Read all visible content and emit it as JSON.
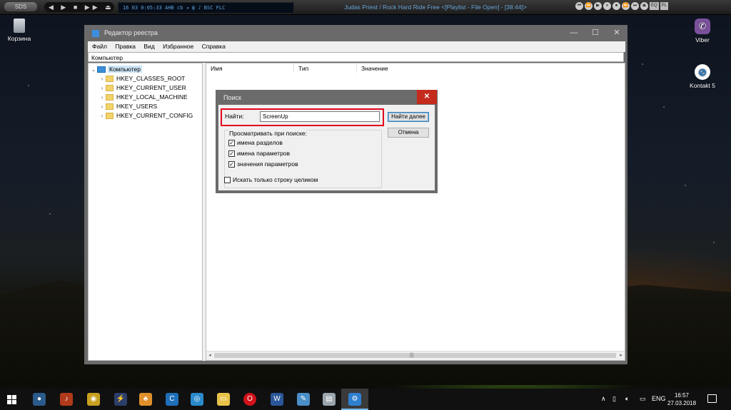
{
  "winamp": {
    "logo": "SDS",
    "controls": "◀ ▶ ■ ▶▶ ⏏",
    "display": "16   03   0:05:33   AHB cb ◂ ф ♪   BSC   FLC",
    "track_title": "Judas Priest / Rock Hard Ride Free   <[Playlist - File Open] - [38:44]>",
    "buttons": [
      "⏮",
      "⏪",
      "▶",
      "⏸",
      "⏹",
      "⏩",
      "⏭",
      "⏏"
    ],
    "mode_labels": [
      "EQ",
      "PL"
    ]
  },
  "desktop_icons": [
    {
      "label": "Корзина",
      "icon": "recycle-bin-icon"
    },
    {
      "label": "Viber",
      "icon": "viber-icon"
    },
    {
      "label": "Kontakt 5",
      "icon": "kontakt-icon"
    }
  ],
  "registry": {
    "title": "Редактор реестра",
    "menu": [
      "Файл",
      "Правка",
      "Вид",
      "Избранное",
      "Справка"
    ],
    "address": "Компьютер",
    "tree_root": "Компьютер",
    "tree_items": [
      "HKEY_CLASSES_ROOT",
      "HKEY_CURRENT_USER",
      "HKEY_LOCAL_MACHINE",
      "HKEY_USERS",
      "HKEY_CURRENT_CONFIG"
    ],
    "columns": [
      "Имя",
      "Тип",
      "Значение"
    ],
    "window_controls": [
      "—",
      "☐",
      "✕"
    ]
  },
  "find_dialog": {
    "title": "Поиск",
    "find_label": "Найти:",
    "find_value": "ScreenUp",
    "find_next_button": "Найти далее",
    "cancel_button": "Отмена",
    "look_at_label": "Просматривать при поиске:",
    "options": [
      {
        "label": "имена разделов",
        "checked": true
      },
      {
        "label": "имена параметров",
        "checked": true
      },
      {
        "label": "значения параметров",
        "checked": true
      }
    ],
    "whole_string": {
      "label": "Искать только строку целиком",
      "checked": false
    },
    "close": "✕"
  },
  "taskbar": {
    "language": "ENG",
    "time": "16:57",
    "date": "27.03.2018",
    "tray_icons": [
      "chevron-up-icon",
      "network-icon",
      "volume-icon",
      "battery-icon"
    ],
    "apps": [
      "firefox-icon",
      "media-icon",
      "owl-icon",
      "winamp-icon",
      "fl-icon",
      "ccleaner-icon",
      "screenshot-icon",
      "explorer-icon",
      "opera-icon",
      "word-icon",
      "notepad-icon",
      "scanner-icon",
      "regedit-icon"
    ]
  },
  "colors": {
    "highlight_red": "#e3001b",
    "close_red": "#c42b1c",
    "folder_yellow": "#f3d36c"
  }
}
